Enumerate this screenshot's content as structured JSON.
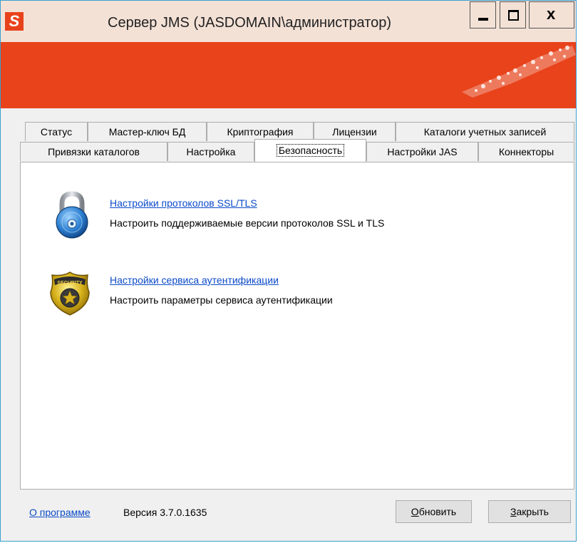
{
  "window": {
    "app_icon_letter": "S",
    "title": "Сервер JMS (JASDOMAIN\\администратор)",
    "close_glyph": "x",
    "colors": {
      "banner": "#e8431b",
      "titlebar": "#f4e1d6",
      "link": "#0b4bc9"
    }
  },
  "tabs": {
    "row1": [
      {
        "label": "Статус"
      },
      {
        "label": "Мастер-ключ БД"
      },
      {
        "label": "Криптография"
      },
      {
        "label": "Лицензии"
      },
      {
        "label": "Каталоги учетных записей"
      }
    ],
    "row2": [
      {
        "label": "Привязки каталогов"
      },
      {
        "label": "Настройка"
      },
      {
        "label": "Безопасность",
        "active": true
      },
      {
        "label": "Настройки JAS"
      },
      {
        "label": "Коннекторы"
      }
    ]
  },
  "security": {
    "items": [
      {
        "icon": "padlock-icon",
        "link": "Настройки протоколов SSL/TLS",
        "description": "Настроить поддерживаемые версии протоколов SSL и TLS"
      },
      {
        "icon": "security-badge-icon",
        "badge_text": "SECURITY",
        "link": "Настройки сервиса аутентификации",
        "description": "Настроить параметры сервиса аутентификации"
      }
    ]
  },
  "footer": {
    "about_link": "О программе",
    "version": "Версия 3.7.0.1635",
    "refresh_first": "О",
    "refresh_rest": "бновить",
    "close_first": "З",
    "close_rest": "акрыть"
  }
}
